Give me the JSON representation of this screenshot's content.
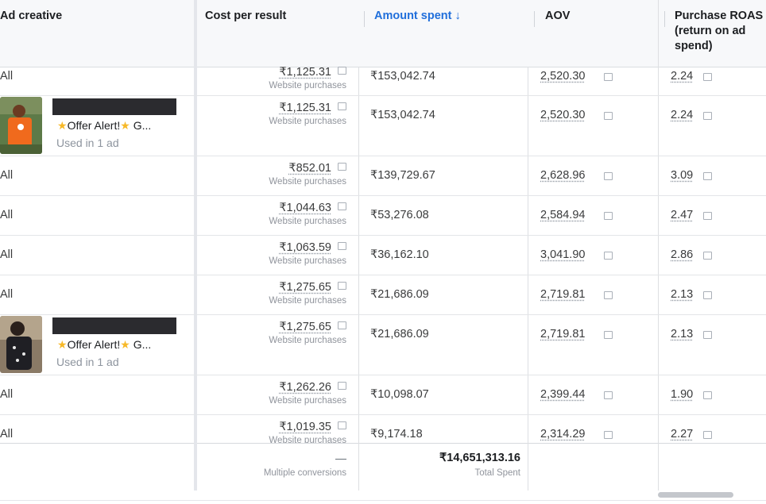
{
  "headers": {
    "ad_creative": "Ad creative",
    "cost_per_result": "Cost per result",
    "amount_spent": "Amount spent ↓",
    "aov": "AOV",
    "roas_line1": "Purchase ROAS",
    "roas_line2": "(return on ad",
    "roas_line3": "spend)"
  },
  "rows": [
    {
      "creative": "All",
      "cpr": "₹1,125.31",
      "cpr_sub": "Website purchases",
      "spent": "₹153,042.74",
      "aov": "2,520.30",
      "roas": "2.24"
    },
    {
      "offer_prefix": "Offer Alert!",
      "offer_suffix": "G...",
      "used": "Used in 1 ad",
      "cpr": "₹1,125.31",
      "cpr_sub": "Website purchases",
      "spent": "₹153,042.74",
      "aov": "2,520.30",
      "roas": "2.24"
    },
    {
      "creative": "All",
      "cpr": "₹852.01",
      "cpr_sub": "Website purchases",
      "spent": "₹139,729.67",
      "aov": "2,628.96",
      "roas": "3.09"
    },
    {
      "creative": "All",
      "cpr": "₹1,044.63",
      "cpr_sub": "Website purchases",
      "spent": "₹53,276.08",
      "aov": "2,584.94",
      "roas": "2.47"
    },
    {
      "creative": "All",
      "cpr": "₹1,063.59",
      "cpr_sub": "Website purchases",
      "spent": "₹36,162.10",
      "aov": "3,041.90",
      "roas": "2.86"
    },
    {
      "creative": "All",
      "cpr": "₹1,275.65",
      "cpr_sub": "Website purchases",
      "spent": "₹21,686.09",
      "aov": "2,719.81",
      "roas": "2.13"
    },
    {
      "offer_prefix": "Offer Alert!",
      "offer_suffix": "G...",
      "used": "Used in 1 ad",
      "cpr": "₹1,275.65",
      "cpr_sub": "Website purchases",
      "spent": "₹21,686.09",
      "aov": "2,719.81",
      "roas": "2.13"
    },
    {
      "creative": "All",
      "cpr": "₹1,262.26",
      "cpr_sub": "Website purchases",
      "spent": "₹10,098.07",
      "aov": "2,399.44",
      "roas": "1.90"
    },
    {
      "creative": "All",
      "cpr": "₹1,019.35",
      "cpr_sub": "Website purchases",
      "spent": "₹9,174.18",
      "aov": "2,314.29",
      "roas": "2.27"
    }
  ],
  "totals": {
    "cpr": "—",
    "cpr_sub": "Multiple conversions",
    "spent": "₹14,651,313.16",
    "spent_sub": "Total Spent"
  },
  "colors": {
    "accent": "#216fdb",
    "header_bg": "#f7f8fa"
  }
}
